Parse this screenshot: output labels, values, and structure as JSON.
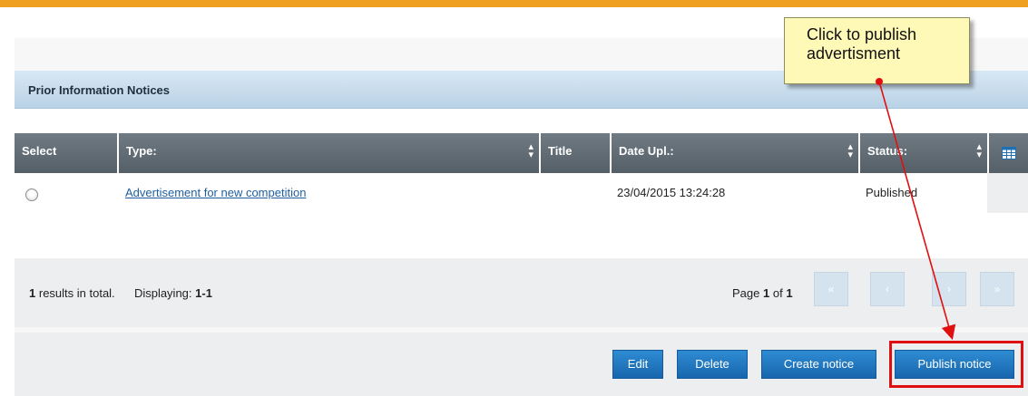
{
  "section": {
    "title": "Prior Information Notices"
  },
  "table": {
    "columns": [
      {
        "label": "Select"
      },
      {
        "label": "Type:"
      },
      {
        "label": "Title"
      },
      {
        "label": "Date Upl.:"
      },
      {
        "label": "Status:"
      }
    ],
    "column_settings_icon": "grid-icon",
    "rows": [
      {
        "type": "Advertisement for new competition",
        "title": "",
        "date_uploaded": "23/04/2015 13:24:28",
        "status": "Published"
      }
    ]
  },
  "pagination": {
    "total_count": "1",
    "total_suffix": "results in total.",
    "displaying_label": "Displaying:",
    "displaying_range": "1-1",
    "page_label": "Page",
    "page_current": "1",
    "page_of": "of",
    "page_total": "1",
    "first_label": "«",
    "prev_label": "‹",
    "next_label": "›",
    "last_label": "»"
  },
  "actions": {
    "edit_label": "Edit",
    "delete_label": "Delete",
    "create_label": "Create notice",
    "publish_label": "Publish notice"
  },
  "annotation": {
    "callout_line1": "Click to publish",
    "callout_line2": "advertisment"
  },
  "colors": {
    "accent_top_bar": "#f0a020",
    "primary_button": "#1f75c2",
    "annotation_red": "#e01010",
    "callout_background": "#fff9b8"
  }
}
